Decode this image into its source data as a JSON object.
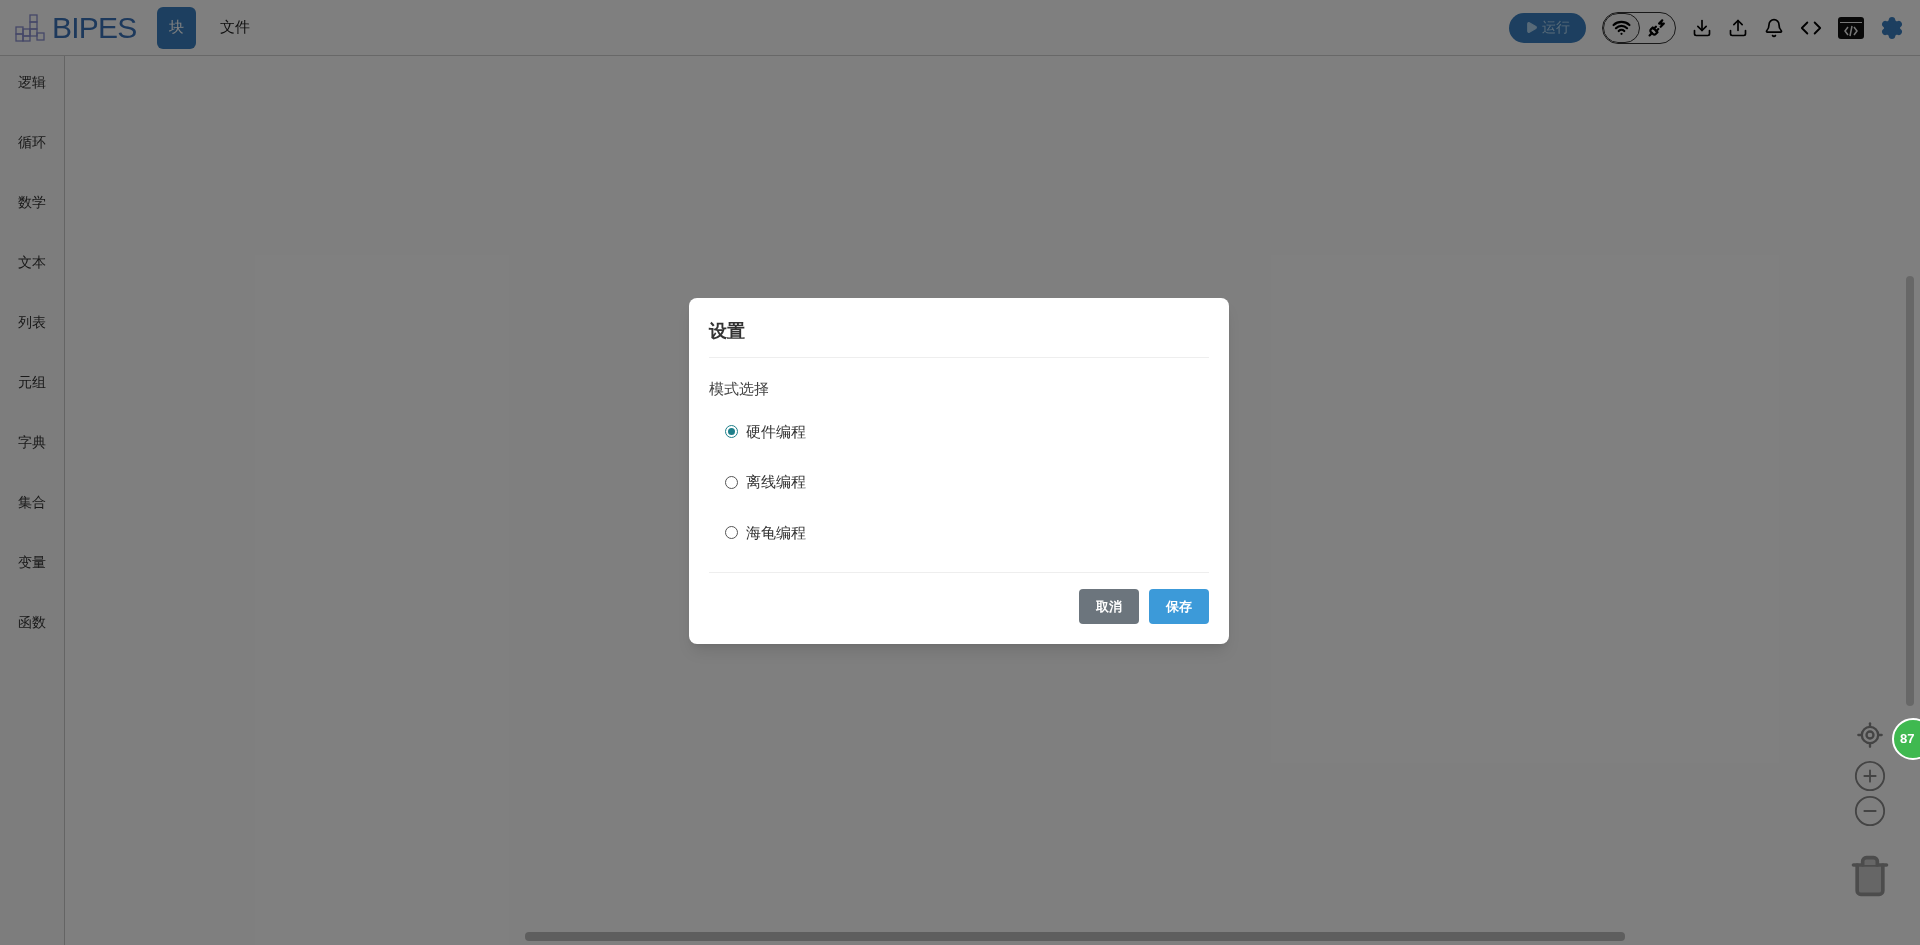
{
  "header": {
    "logo": "BIPES",
    "tabs": [
      {
        "label": "块",
        "selected": true
      },
      {
        "label": "文件",
        "selected": false
      }
    ],
    "run_button": "运行"
  },
  "sidebar": {
    "items": [
      "逻辑",
      "循环",
      "数学",
      "文本",
      "列表",
      "元组",
      "字典",
      "集合",
      "变量",
      "函数"
    ]
  },
  "dialog": {
    "title": "设置",
    "section_label": "模式选择",
    "options": [
      {
        "label": "硬件编程",
        "selected": true
      },
      {
        "label": "离线编程",
        "selected": false
      },
      {
        "label": "海龟编程",
        "selected": false
      }
    ],
    "buttons": [
      {
        "label": "取消",
        "kind": "secondary"
      },
      {
        "label": "保存",
        "kind": "primary"
      }
    ]
  },
  "connection": [
    {
      "kind": "wifi",
      "selected": true
    },
    {
      "kind": "usb",
      "selected": false
    }
  ],
  "floating_badge": "87"
}
